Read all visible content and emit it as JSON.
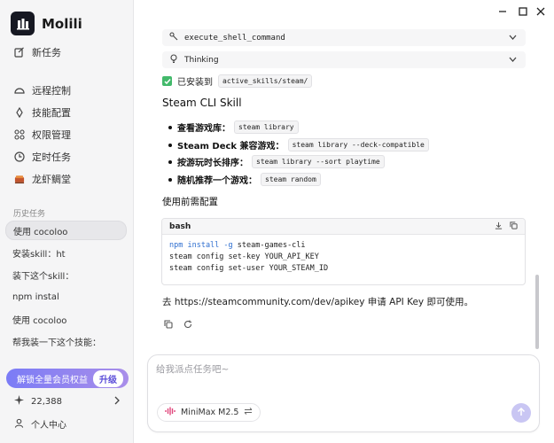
{
  "app": {
    "name": "Molili"
  },
  "sidebar": {
    "new_task": "新任务",
    "nav": [
      {
        "label": "远程控制",
        "icon": "remote-control-icon"
      },
      {
        "label": "技能配置",
        "icon": "skill-config-icon"
      },
      {
        "label": "权限管理",
        "icon": "permission-icon"
      },
      {
        "label": "定时任务",
        "icon": "clock-icon"
      },
      {
        "label": "龙虾鲷堂",
        "icon": "shrimp-icon"
      }
    ],
    "history_label": "历史任务",
    "history": [
      "使用 cocoloo",
      "安装skill：ht",
      "装下这个skill：",
      "npm instal",
      "使用 cocoloo",
      "帮我装一下这个技能："
    ],
    "promo": {
      "text": "解锁全量会员权益",
      "button": "升级"
    },
    "points": "22,388",
    "profile": "个人中心"
  },
  "window_controls": [
    "minimize",
    "maximize",
    "close"
  ],
  "main": {
    "tool_call": {
      "label": "execute_shell_command"
    },
    "thinking": {
      "label": "Thinking"
    },
    "installed": {
      "prefix": "已安装到",
      "path": "active_skills/steam/"
    },
    "heading": "Steam CLI Skill",
    "bullets": [
      {
        "label": "查看游戏库：",
        "code": "steam library"
      },
      {
        "label": "Steam Deck 兼容游戏：",
        "code": "steam library --deck-compatible"
      },
      {
        "label": "按游玩时长排序：",
        "code": "steam library --sort playtime"
      },
      {
        "label": "随机推荐一个游戏：",
        "code": "steam random"
      }
    ],
    "pre_config_title": "使用前需配置",
    "code_block": {
      "lang": "bash",
      "line1_cmd": "npm install -g",
      "line1_arg": " steam-games-cli",
      "line2": "steam config set-key YOUR_API_KEY",
      "line3": "steam config set-user YOUR_STEAM_ID"
    },
    "note": "去 https://steamcommunity.com/dev/apikey 申请 API Key 即可使用。"
  },
  "composer": {
    "placeholder": "给我派点任务吧~",
    "model": "MiniMax M2.5"
  },
  "colors": {
    "accent": "#7b7cf6",
    "send_button": "#c9c6f3",
    "check": "#43b96b",
    "code_keyword": "#2f6fd0"
  }
}
